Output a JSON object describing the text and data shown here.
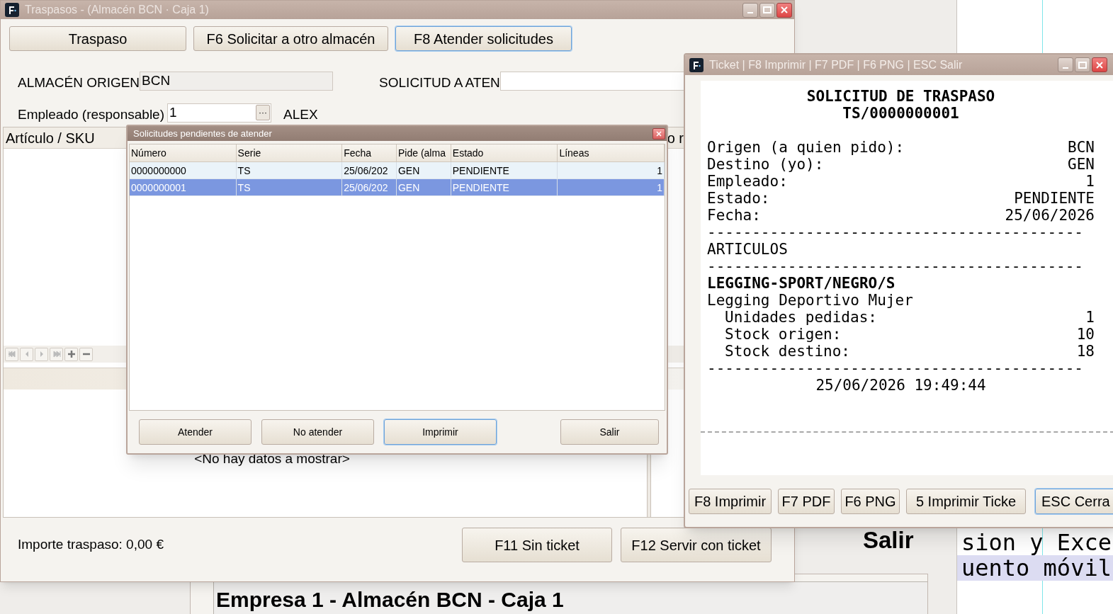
{
  "background": {
    "side_rows": [
      {
        "text": "sion y Exce",
        "selected": false
      },
      {
        "text": "uento móvil",
        "selected": true
      }
    ],
    "side_label": "Salir",
    "back_window_title": "Empresa 1 - Almacén BCN - Caja 1"
  },
  "main_window": {
    "title": "Traspasos - (Almacén BCN · Caja 1)",
    "modes": [
      {
        "label": "Traspaso",
        "selected": false
      },
      {
        "label": "F6 Solicitar a otro almacén",
        "selected": false
      },
      {
        "label": "F8 Atender solicitudes",
        "selected": true
      }
    ],
    "origin_label": "ALMACÉN ORIGEN",
    "origin_value": "BCN",
    "request_label": "SOLICITUD A ATEN",
    "employee_label": "Empleado (responsable)",
    "employee_value": "1",
    "employee_button": "···",
    "employee_name": "ALEX",
    "grid": {
      "columns": [
        "Artículo / SKU",
        "o r"
      ],
      "empty_text": "<No hay datos a mostrar>"
    },
    "total": "Importe traspaso: 0,00 €",
    "buttons": [
      "F11 Sin ticket",
      "F12 Servir con ticket"
    ]
  },
  "dialog": {
    "title": "Solicitudes pendientes de atender",
    "columns": [
      "Número",
      "Serie",
      "Fecha",
      "Pide (alma",
      "Estado",
      "Líneas"
    ],
    "rows": [
      {
        "cells": [
          "0000000000",
          "TS",
          "25/06/202",
          "GEN",
          "PENDIENTE",
          "1"
        ],
        "selected": false
      },
      {
        "cells": [
          "0000000001",
          "TS",
          "25/06/202",
          "GEN",
          "PENDIENTE",
          "1"
        ],
        "selected": true
      }
    ],
    "buttons": [
      {
        "label": "Atender",
        "focused": false
      },
      {
        "label": "No atender",
        "focused": false
      },
      {
        "label": "Imprimir",
        "focused": true
      },
      {
        "label": "Salir",
        "focused": false
      }
    ]
  },
  "ticket_window": {
    "title": "Ticket | F8 Imprimir | F7 PDF | F6 PNG | ESC Salir",
    "lines": [
      {
        "kind": "heading",
        "text": "SOLICITUD DE TRASPASO"
      },
      {
        "kind": "heading",
        "text": "TS/0000000001"
      },
      {
        "kind": "spacer"
      },
      {
        "kind": "pair",
        "label": "Origen (a quien pido):",
        "value": "BCN"
      },
      {
        "kind": "pair",
        "label": "Destino (yo):",
        "value": "GEN"
      },
      {
        "kind": "pair",
        "label": "Empleado:",
        "value": "1"
      },
      {
        "kind": "pair",
        "label": "Estado:",
        "value": "PENDIENTE"
      },
      {
        "kind": "pair",
        "label": "Fecha:",
        "value": "25/06/2026"
      },
      {
        "kind": "text",
        "text": "------------------------------------------"
      },
      {
        "kind": "text",
        "text": "ARTICULOS"
      },
      {
        "kind": "text",
        "text": "------------------------------------------"
      },
      {
        "kind": "bold",
        "text": "LEGGING-SPORT/NEGRO/S"
      },
      {
        "kind": "text",
        "text": "Legging Deportivo Mujer"
      },
      {
        "kind": "indent_pair",
        "label": "Unidades pedidas:",
        "value": "1"
      },
      {
        "kind": "indent_pair",
        "label": "Stock origen:",
        "value": "10"
      },
      {
        "kind": "indent_pair",
        "label": "Stock destino:",
        "value": "18"
      },
      {
        "kind": "text",
        "text": "------------------------------------------"
      },
      {
        "kind": "center",
        "text": "25/06/2026 19:49:44"
      }
    ],
    "buttons": [
      {
        "label": "F8 Imprimir",
        "focused": false
      },
      {
        "label": "F7 PDF",
        "focused": false
      },
      {
        "label": "F6 PNG",
        "focused": false
      },
      {
        "label": "5 Imprimir Ticke",
        "focused": false
      },
      {
        "label": "ESC Cerra",
        "focused": true
      }
    ]
  }
}
